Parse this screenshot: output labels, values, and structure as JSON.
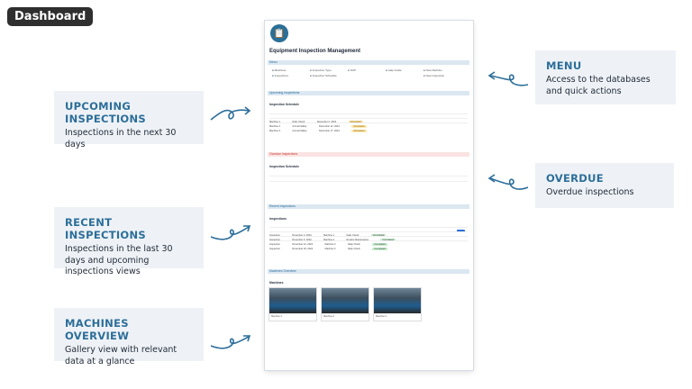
{
  "badge": "Dashboard",
  "callouts": {
    "upcoming": {
      "title": "UPCOMING INSPECTIONS",
      "desc": "Inspections in the next 30 days"
    },
    "recent": {
      "title": "RECENT INSPECTIONS",
      "desc": "Inspections in the last 30 days and upcoming inspections views"
    },
    "machines": {
      "title": "MACHINES OVERVIEW",
      "desc": "Gallery view with relevant data at a glance"
    },
    "menu": {
      "title": "MENU",
      "desc": "Access to the databases and quick actions"
    },
    "overdue": {
      "title": "OVERDUE",
      "desc": "Overdue inspections"
    }
  },
  "panel": {
    "title": "Equipment Inspection Management",
    "sections": {
      "menu": "Menu",
      "upcoming": "Upcoming Inspections",
      "overdue": "Overdue Inspections",
      "recent": "Recent Inspections",
      "machines": "Machines Overview"
    },
    "menu_items": [
      "Machines",
      "Inspection Type",
      "SOP",
      "Help Guide",
      "New Machine",
      "Inspections",
      "Inspection Schedule",
      "",
      "",
      "New Inspection"
    ],
    "sub_schedule": "Inspection Schedule",
    "sub_inspections": "Inspections",
    "sub_machines": "Machines",
    "upcoming_rows": [
      [
        "Machine 1",
        "Daily Check",
        "December 2, 2024",
        "Scheduled"
      ],
      [
        "Machine 2",
        "Annual Safety",
        "December 12, 2024",
        "Scheduled"
      ],
      [
        "Machine 3",
        "Annual Safety",
        "December 17, 2024",
        "Scheduled"
      ]
    ],
    "recent_rows": [
      [
        "Inspection",
        "November 4, 2024",
        "Machine 1",
        "Daily Check",
        "Completed"
      ],
      [
        "Inspection",
        "November 6, 2024",
        "Machine 2",
        "Routine Maintenance",
        "Completed"
      ],
      [
        "Inspection",
        "November 12, 2024",
        "Machine 3",
        "Daily Check",
        "Completed"
      ],
      [
        "Inspection",
        "November 18, 2024",
        "Machine 3",
        "Daily Check",
        "Completed"
      ]
    ],
    "machine_cards": [
      "Machine 1",
      "Machine 2",
      "Machine 3"
    ]
  }
}
